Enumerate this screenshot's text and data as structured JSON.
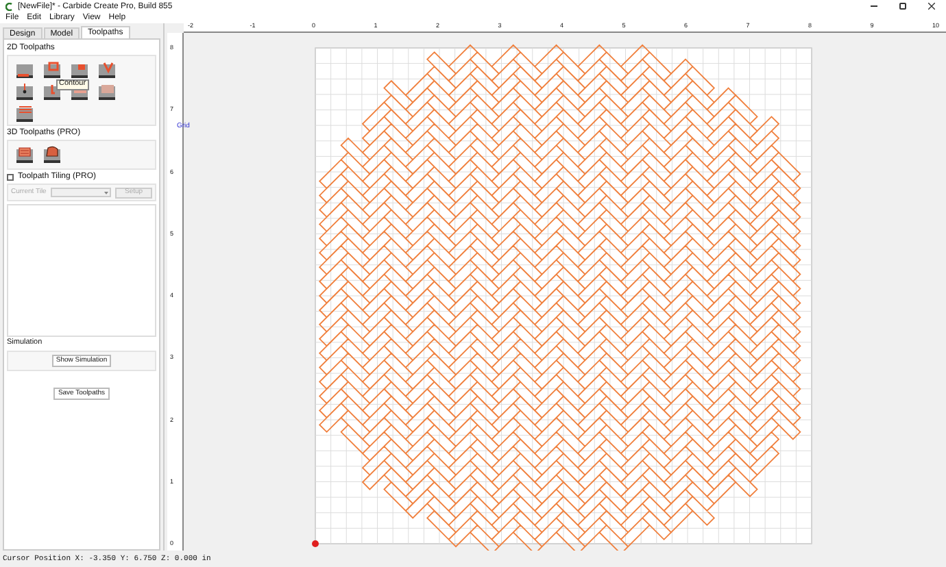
{
  "window": {
    "title": "[NewFile]* - Carbide Create Pro, Build 855"
  },
  "menu": [
    "File",
    "Edit",
    "Library",
    "View",
    "Help"
  ],
  "tabs": [
    {
      "label": "Design",
      "selected": false
    },
    {
      "label": "Model",
      "selected": false
    },
    {
      "label": "Toolpaths",
      "selected": true
    }
  ],
  "toolpaths_2d": {
    "title": "2D Toolpaths",
    "tooltip": "Contour"
  },
  "toolpaths_3d": {
    "title": "3D Toolpaths (PRO)"
  },
  "tiling": {
    "label": "Toolpath Tiling (PRO)",
    "checked": false,
    "current_tile_label": "Current Tile",
    "setup_button": "Setup",
    "disabled": true
  },
  "simulation": {
    "title": "Simulation",
    "show_button": "Show Simulation"
  },
  "save_button": "Save Toolpaths",
  "ruler": {
    "x_labels": [
      "-2",
      "-1",
      "0",
      "1",
      "2",
      "3",
      "4",
      "5",
      "6",
      "7",
      "8",
      "9",
      "10"
    ],
    "y_labels": [
      "8",
      "7",
      "6",
      "5",
      "4",
      "3",
      "2",
      "1",
      "0"
    ],
    "grid_label": "Grid"
  },
  "status_bar": "Cursor Position X: -3.350 Y: 6.750 Z: 0.000 in"
}
